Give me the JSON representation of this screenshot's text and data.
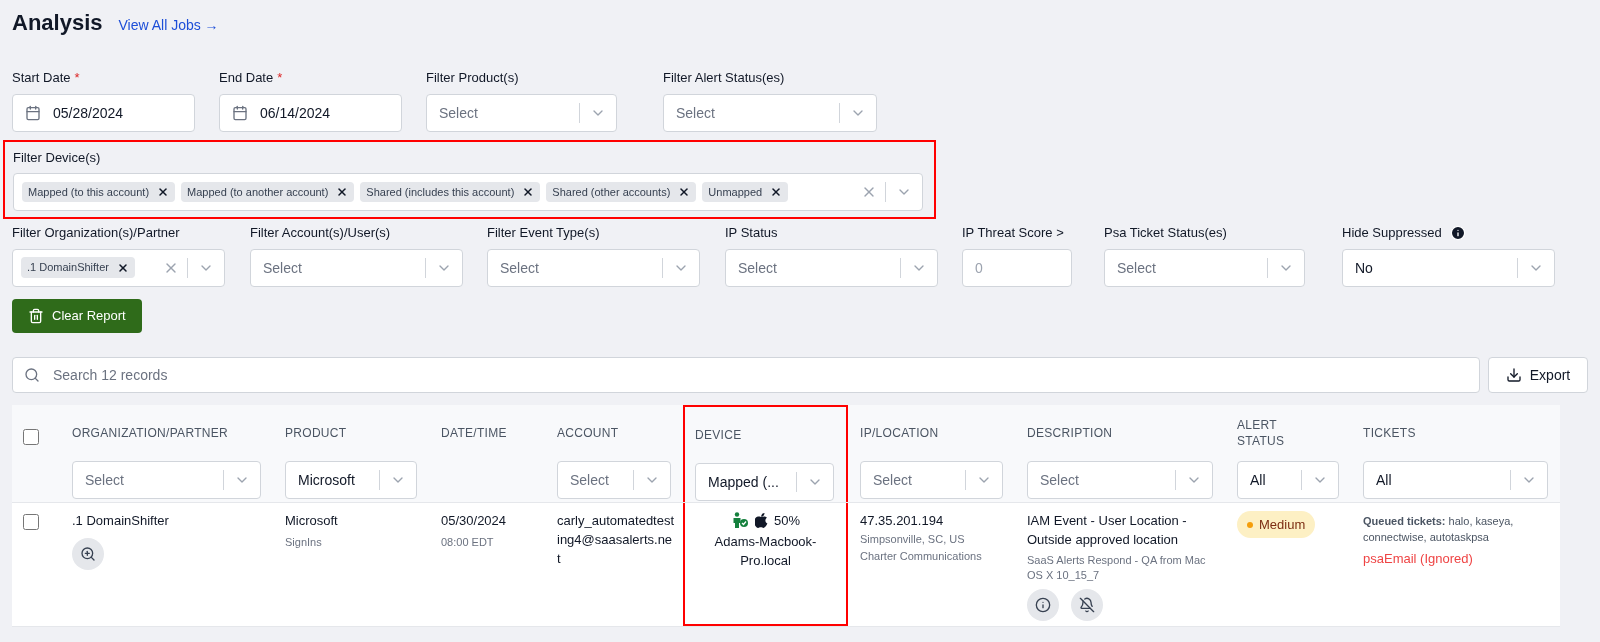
{
  "header": {
    "title": "Analysis",
    "link": "View All Jobs →"
  },
  "filters_top": [
    {
      "kind": "date",
      "label": "Start Date",
      "required_mark": "*",
      "value": "05/28/2024"
    },
    {
      "kind": "date",
      "label": "End Date",
      "required_mark": "*",
      "value": "06/14/2024"
    },
    {
      "kind": "select",
      "label": "Filter Product(s)",
      "placeholder": "Select"
    },
    {
      "kind": "select",
      "label": "Filter Alert Status(es)",
      "placeholder": "Select"
    }
  ],
  "device_filter": {
    "label": "Filter Device(s)",
    "highlighted": true,
    "tags": [
      "Mapped (to this account)",
      "Mapped (to another account)",
      "Shared (includes this account)",
      "Shared (other accounts)",
      "Unmapped"
    ]
  },
  "filters_bottom": [
    {
      "kind": "tags",
      "label": "Filter Organization(s)/Partner",
      "tags": [
        ".1 DomainShifter"
      ]
    },
    {
      "kind": "select",
      "label": "Filter Account(s)/User(s)",
      "placeholder": "Select"
    },
    {
      "kind": "select",
      "label": "Filter Event Type(s)",
      "placeholder": "Select"
    },
    {
      "kind": "select",
      "label": "IP Status",
      "placeholder": "Select"
    },
    {
      "kind": "number",
      "label": "IP Threat Score >",
      "placeholder": "0"
    },
    {
      "kind": "select",
      "label": "Psa Ticket Status(es)",
      "placeholder": "Select"
    },
    {
      "kind": "value",
      "label": "Hide Suppressed",
      "info": true,
      "value": "No"
    }
  ],
  "clear_button": "Clear Report",
  "search": {
    "placeholder": "Search 12 records"
  },
  "export_button": "Export",
  "table": {
    "select_all": false,
    "columns": [
      {
        "label": "ORGANIZATION/PARTNER",
        "highlighted": false,
        "filter": {
          "placeholder": "Select"
        }
      },
      {
        "label": "PRODUCT",
        "highlighted": false,
        "filter": {
          "value": "Microsoft"
        }
      },
      {
        "label": "DATE/TIME",
        "highlighted": false
      },
      {
        "label": "ACCOUNT",
        "highlighted": false,
        "filter": {
          "placeholder": "Select"
        }
      },
      {
        "label": "DEVICE",
        "highlighted": true,
        "filter": {
          "value": "Mapped (..."
        }
      },
      {
        "label": "IP/LOCATION",
        "highlighted": false,
        "filter": {
          "placeholder": "Select"
        }
      },
      {
        "label": "DESCRIPTION",
        "highlighted": false,
        "filter": {
          "placeholder": "Select"
        }
      },
      {
        "label": "ALERT STATUS",
        "highlighted": false,
        "filter": {
          "value": "All"
        }
      },
      {
        "label": "TICKETS",
        "highlighted": false,
        "filter": {
          "value": "All"
        }
      }
    ],
    "rows": [
      {
        "checked": false,
        "organization": ".1 DomainShifter",
        "product": "Microsoft",
        "product_sub": "SignIns",
        "date": "05/30/2024",
        "time": "08:00 EDT",
        "account": "carly_automatedtesting4@saasalerts.net",
        "device_percent": "50%",
        "device_name": "Adams-Macbook-Pro.local",
        "ip": "47.35.201.194",
        "location": "Simpsonville, SC, US",
        "isp": "Charter Communications",
        "description": "IAM Event - User Location - Outside approved location",
        "description_sub": "SaaS Alerts Respond - QA from Mac OS X 10_15_7",
        "alert": {
          "label": "Medium",
          "color": "#f59e0b"
        },
        "tickets": "**Queued tickets:** halo, kaseya, connectwise, autotaskpsa",
        "ticket_status": "psaEmail (Ignored)"
      }
    ]
  }
}
